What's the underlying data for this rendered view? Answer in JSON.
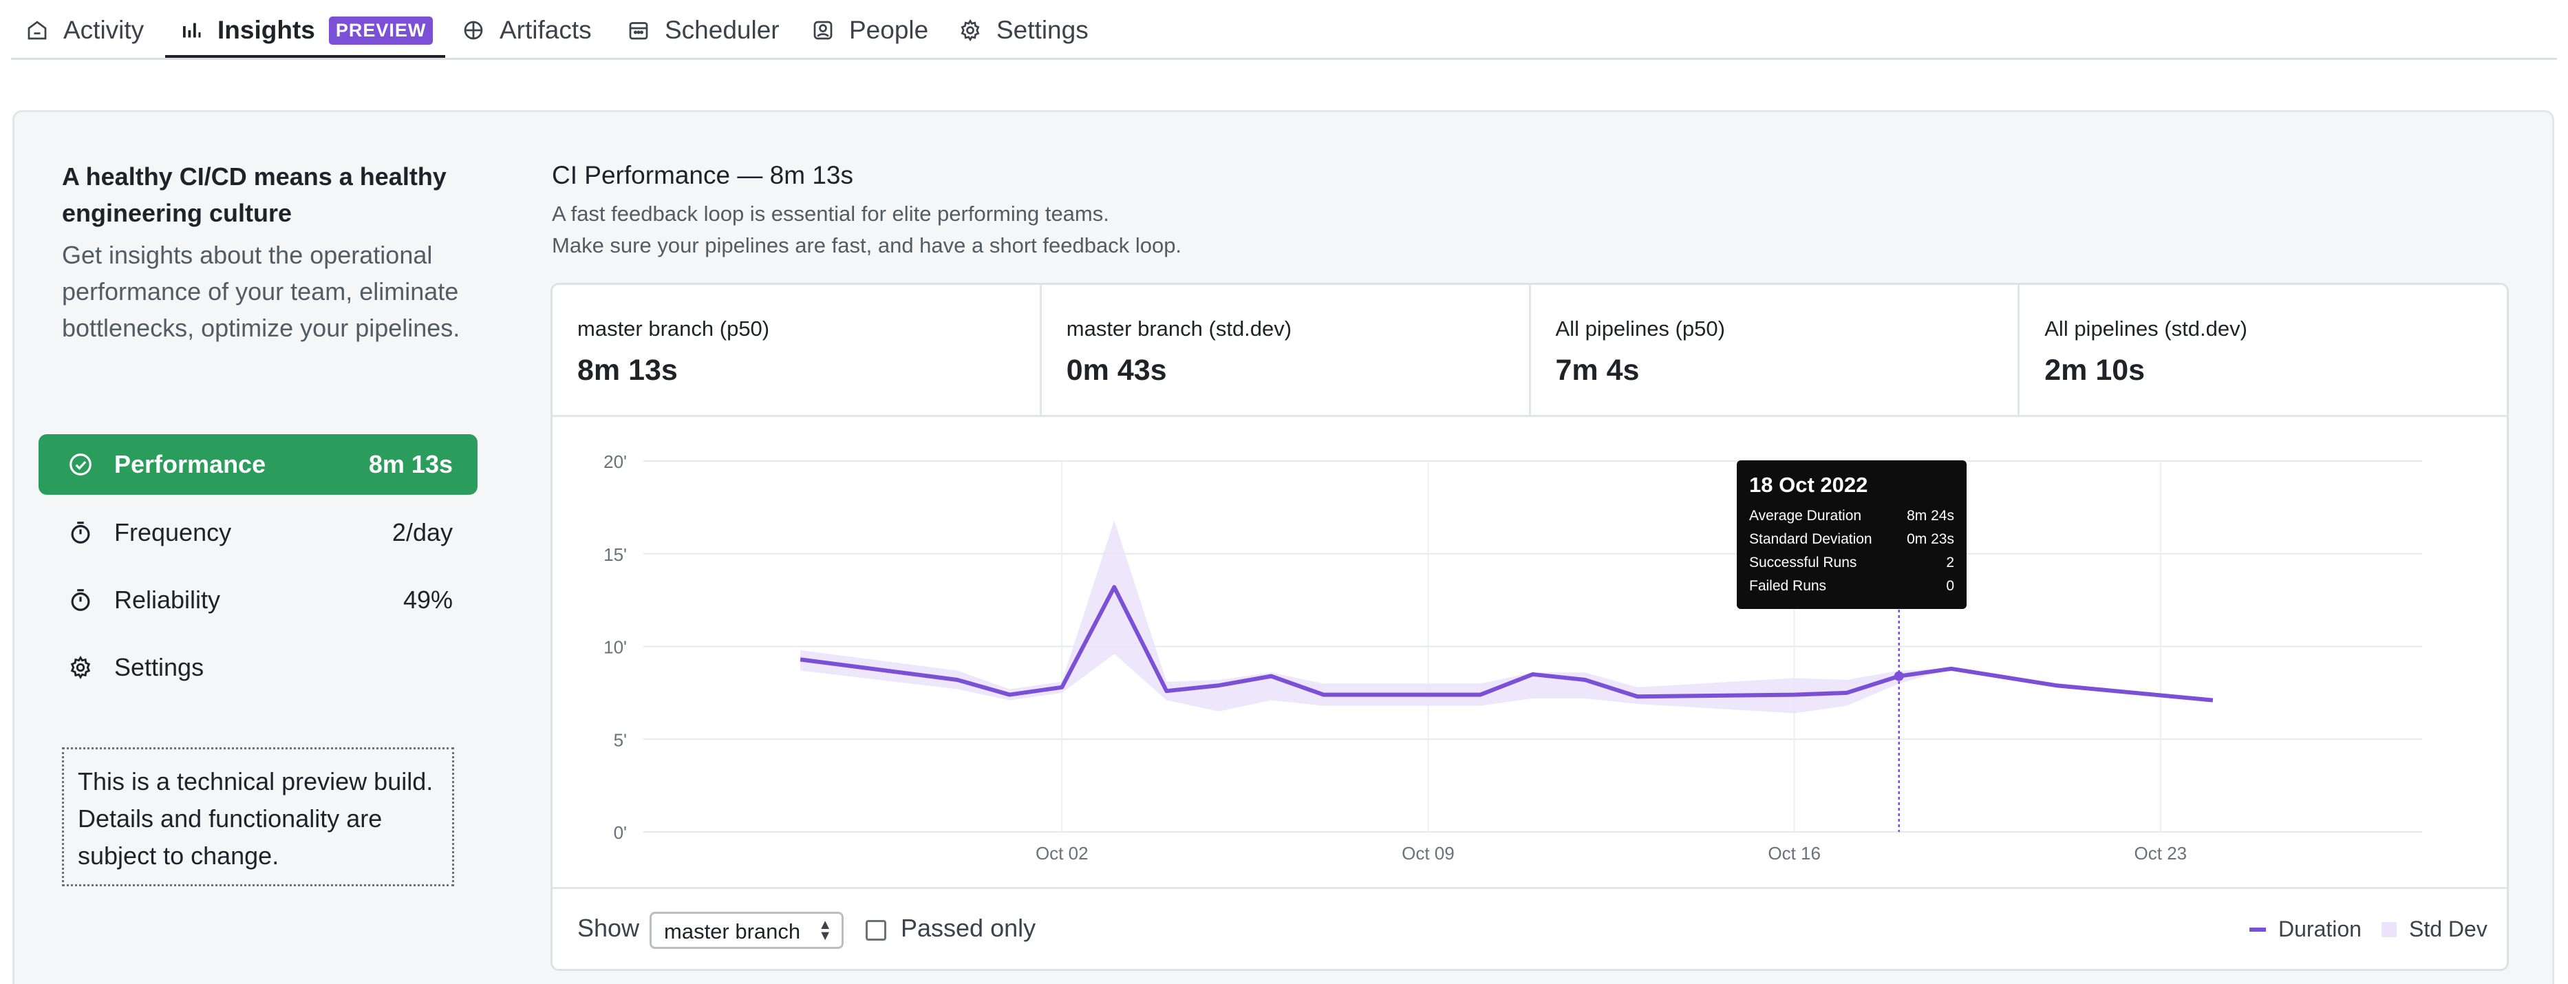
{
  "nav": {
    "tabs": [
      {
        "label": "Activity",
        "icon": "home-icon"
      },
      {
        "label": "Insights",
        "icon": "bar-chart-icon",
        "badge": "PREVIEW",
        "active": true
      },
      {
        "label": "Artifacts",
        "icon": "box-icon"
      },
      {
        "label": "Scheduler",
        "icon": "calendar-icon"
      },
      {
        "label": "People",
        "icon": "person-icon"
      },
      {
        "label": "Settings",
        "icon": "gear-icon"
      }
    ]
  },
  "sidebar": {
    "title": "A healthy CI/CD means a healthy engineering culture",
    "description": "Get insights about the operational performance of your team, eliminate bottlenecks, optimize your pipelines.",
    "items": [
      {
        "label": "Performance",
        "value": "8m 13s",
        "icon": "check-circle-icon",
        "active": true
      },
      {
        "label": "Frequency",
        "value": "2/day",
        "icon": "stopwatch-icon"
      },
      {
        "label": "Reliability",
        "value": "49%",
        "icon": "stopwatch-icon"
      },
      {
        "label": "Settings",
        "value": "",
        "icon": "gear-icon"
      }
    ],
    "note": "This is a technical preview build. Details and functionality are subject to change."
  },
  "main": {
    "title": "CI Performance — 8m 13s",
    "subtitle_line1": "A fast feedback loop is essential for elite performing teams.",
    "subtitle_line2": "Make sure your pipelines are fast, and have a short feedback loop.",
    "stats": [
      {
        "label": "master branch (p50)",
        "value": "8m 13s"
      },
      {
        "label": "master branch (std.dev)",
        "value": "0m 43s"
      },
      {
        "label": "All pipelines (p50)",
        "value": "7m 4s"
      },
      {
        "label": "All pipelines (std.dev)",
        "value": "2m 10s"
      }
    ],
    "controls": {
      "show_label": "Show",
      "branch_select": "master branch",
      "passed_only_label": "Passed only",
      "passed_only_checked": false
    }
  },
  "chart_data": {
    "type": "line",
    "x_unit": "date",
    "x": [
      "2022-09-27",
      "2022-09-30",
      "2022-10-01",
      "2022-10-02",
      "2022-10-03",
      "2022-10-04",
      "2022-10-05",
      "2022-10-06",
      "2022-10-07",
      "2022-10-08",
      "2022-10-09",
      "2022-10-10",
      "2022-10-11",
      "2022-10-12",
      "2022-10-13",
      "2022-10-16",
      "2022-10-17",
      "2022-10-18",
      "2022-10-19",
      "2022-10-21",
      "2022-10-24"
    ],
    "series": [
      {
        "name": "Duration",
        "color": "#7b4fd6",
        "values": [
          9.3,
          8.2,
          7.4,
          7.8,
          13.2,
          7.6,
          7.9,
          8.4,
          7.4,
          7.4,
          7.4,
          7.4,
          8.5,
          8.2,
          7.3,
          7.4,
          7.5,
          8.4,
          8.8,
          7.9,
          7.1
        ]
      },
      {
        "name": "Std Dev",
        "color": "#ebe3fb",
        "lower": [
          8.7,
          7.7,
          7.1,
          7.5,
          9.6,
          7.1,
          6.5,
          7.1,
          6.8,
          6.8,
          6.8,
          6.8,
          7.2,
          7.2,
          6.9,
          6.4,
          6.8,
          8.0,
          8.8,
          7.9,
          7.1
        ],
        "upper": [
          9.8,
          8.7,
          7.7,
          8.1,
          16.8,
          8.1,
          8.2,
          8.6,
          8.0,
          8.0,
          8.0,
          8.0,
          8.6,
          8.6,
          7.8,
          8.3,
          8.2,
          8.7,
          8.8,
          7.9,
          7.1
        ]
      }
    ],
    "x_ticks": [
      "Oct 02",
      "Oct 09",
      "Oct 16",
      "Oct 23"
    ],
    "y_ticks": [
      "0'",
      "5'",
      "10'",
      "15'",
      "20'"
    ],
    "ylim": [
      0,
      20
    ],
    "grid": true,
    "legend": "bottom-right",
    "legend_items": [
      "Duration",
      "Std Dev"
    ],
    "hover_date": "2022-10-18",
    "tooltip": {
      "title": "18 Oct 2022",
      "rows": [
        {
          "label": "Average Duration",
          "value": "8m 24s"
        },
        {
          "label": "Standard Deviation",
          "value": "0m 23s"
        },
        {
          "label": "Successful Runs",
          "value": "2"
        },
        {
          "label": "Failed Runs",
          "value": "0"
        }
      ]
    }
  }
}
